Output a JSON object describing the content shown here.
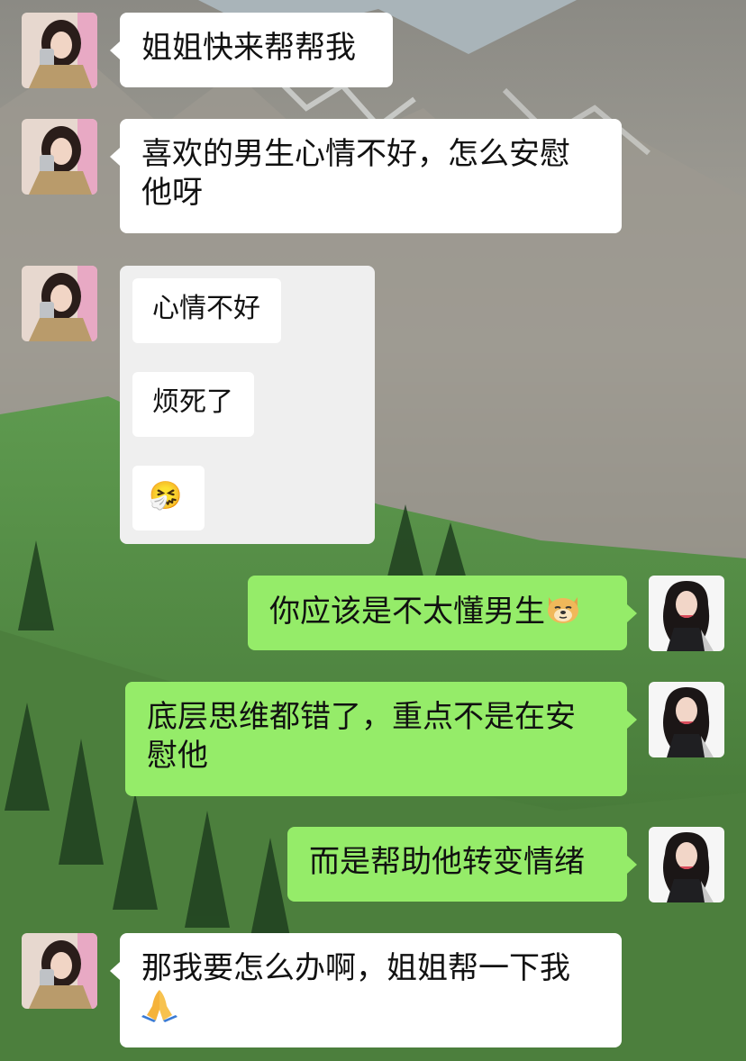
{
  "messages": [
    {
      "from": "friend",
      "text": "姐姐快来帮帮我"
    },
    {
      "from": "friend",
      "text": "喜欢的男生心情不好，怎么安慰他呀"
    },
    {
      "from": "friend",
      "forwarded_items": [
        "心情不好",
        "烦死了",
        "🤧"
      ]
    },
    {
      "from": "me",
      "text": "你应该是不太懂男生",
      "emoji": "doge-icon"
    },
    {
      "from": "me",
      "text": "底层思维都错了，重点不是在安慰他"
    },
    {
      "from": "me",
      "text": "而是帮助他转变情绪"
    },
    {
      "from": "friend",
      "text": "那我要怎么办啊，姐姐帮一下我",
      "emoji": "pray-icon"
    }
  ],
  "colors": {
    "incoming_bubble": "#ffffff",
    "outgoing_bubble": "#95ec69",
    "forward_card": "#efefef"
  }
}
